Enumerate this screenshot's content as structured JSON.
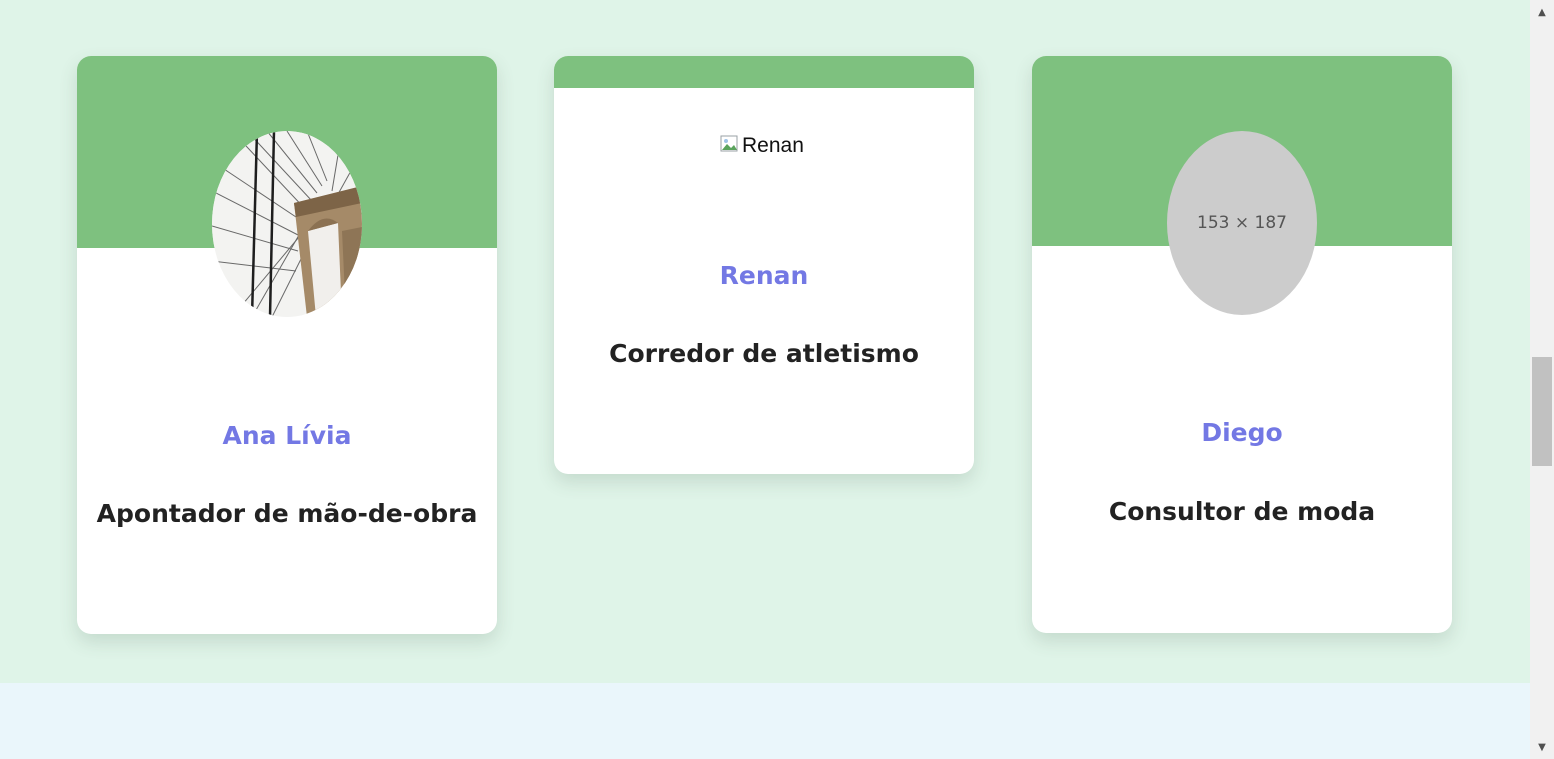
{
  "team": {
    "cards": [
      {
        "name": "Ana Lívia",
        "role": "Apontador de mão-de-obra",
        "photo": "bridge-photo"
      },
      {
        "name": "Renan",
        "role": "Corredor de atletismo",
        "image_alt": "Renan"
      },
      {
        "name": "Diego",
        "role": "Consultor de moda",
        "placeholder_text": "153 × 187"
      }
    ]
  },
  "colors": {
    "page_background": "#dff4e8",
    "next_section_background": "#eaf6fb",
    "card_header": "#7ec17f",
    "name_text": "#7378e4",
    "role_text": "#222222"
  },
  "icons": {
    "scroll_up": "triangle-up-icon",
    "scroll_down": "triangle-down-icon",
    "broken_image": "broken-image-icon"
  }
}
